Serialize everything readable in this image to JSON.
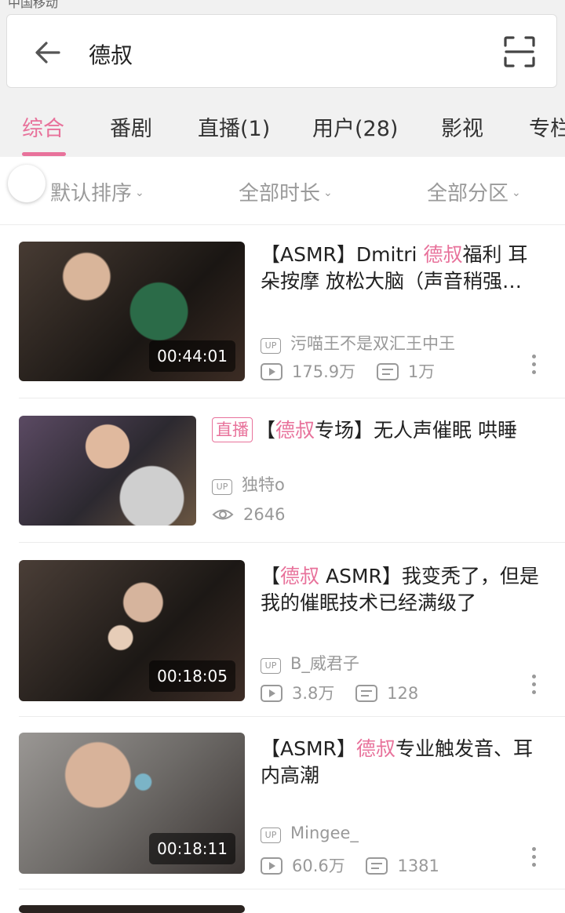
{
  "status_bar": {
    "carrier": "中国移动"
  },
  "search": {
    "query": "德叔"
  },
  "tabs": [
    {
      "label": "综合",
      "active": true
    },
    {
      "label": "番剧"
    },
    {
      "label": "直播(1)"
    },
    {
      "label": "用户(28)"
    },
    {
      "label": "影视"
    },
    {
      "label": "专栏"
    }
  ],
  "filters": [
    {
      "label": "默认排序"
    },
    {
      "label": "全部时长"
    },
    {
      "label": "全部分区"
    }
  ],
  "results": [
    {
      "title_parts": [
        "【ASMR】Dmitri ",
        "德叔",
        "福利 耳"
      ],
      "title_line2": "朵按摩 放松大脑（声音稍强…",
      "uploader": "污喵王不是双汇王中王",
      "plays": "175.9万",
      "danmaku": "1万",
      "duration": "00:44:01"
    },
    {
      "live_label": "直播",
      "title_parts": [
        "【",
        "德叔",
        "专场】无人声催眠 哄睡"
      ],
      "uploader": "独特o",
      "viewers": "2646"
    },
    {
      "title_parts": [
        "【",
        "德叔",
        " ASMR】我变秃了，但是"
      ],
      "title_line2": "我的催眠技术已经满级了",
      "uploader": "B_威君子",
      "plays": "3.8万",
      "danmaku": "128",
      "duration": "00:18:05"
    },
    {
      "title_parts": [
        "【ASMR】",
        "德叔",
        "专业触发音、耳"
      ],
      "title_line2": "内高潮",
      "uploader": "Mingee_",
      "plays": "60.6万",
      "danmaku": "1381",
      "duration": "00:18:11"
    }
  ],
  "colors": {
    "accent": "#e8729b",
    "muted": "#999999",
    "header_bg": "#f1f1f1"
  },
  "icons": [
    "back-arrow-icon",
    "scan-icon",
    "up-icon",
    "play-count-icon",
    "danmaku-icon",
    "eye-icon",
    "more-icon"
  ]
}
